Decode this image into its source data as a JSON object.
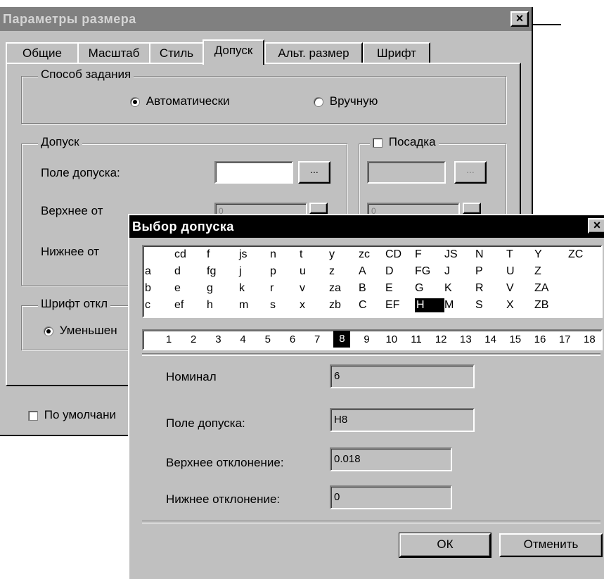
{
  "outer_dialog": {
    "title": "Параметры размера",
    "close_label": "×",
    "tabs": [
      {
        "label": "Общие"
      },
      {
        "label": "Масштаб"
      },
      {
        "label": "Стиль"
      },
      {
        "label": "Допуск"
      },
      {
        "label": "Альт. размер"
      },
      {
        "label": "Шрифт"
      }
    ],
    "method_group": {
      "legend": "Способ задания",
      "auto_label": "Автоматически",
      "manual_label": "Вручную"
    },
    "tolerance_group": {
      "legend": "Допуск",
      "field_label": "Поле допуска:",
      "upper_label": "Верхнее от",
      "lower_label": "Нижнее от",
      "upper_value": "0",
      "fit_upper_value": "0",
      "browse_label": "..."
    },
    "fit_group": {
      "legend": "Посадка",
      "browse_label": "..."
    },
    "font_group": {
      "legend": "Шрифт откл",
      "option_label": "Уменьшен"
    },
    "default_label": "По умолчани"
  },
  "tolerance_dialog": {
    "title": "Выбор допуска",
    "close_label": "×",
    "letter_grid": [
      [
        "",
        "cd",
        "f",
        "js",
        "n",
        "t",
        "y",
        "zc",
        "CD",
        "F",
        "JS",
        "N",
        "T",
        "Y",
        "ZC"
      ],
      [
        "a",
        "d",
        "fg",
        "j",
        "p",
        "u",
        "z",
        "A",
        "D",
        "FG",
        "J",
        "P",
        "U",
        "Z",
        ""
      ],
      [
        "b",
        "e",
        "g",
        "k",
        "r",
        "v",
        "za",
        "B",
        "E",
        "G",
        "K",
        "R",
        "V",
        "ZA",
        ""
      ],
      [
        "c",
        "ef",
        "h",
        "m",
        "s",
        "x",
        "zb",
        "C",
        "EF",
        "H",
        "M",
        "S",
        "X",
        "ZB",
        ""
      ]
    ],
    "selected_letter": "H",
    "grades": [
      "1",
      "2",
      "3",
      "4",
      "5",
      "6",
      "7",
      "8",
      "9",
      "10",
      "11",
      "12",
      "13",
      "14",
      "15",
      "16",
      "17",
      "18"
    ],
    "selected_grade": "8",
    "nominal_label": "Номинал",
    "nominal_value": "6",
    "field_label": "Поле допуска:",
    "field_value": "H8",
    "upper_label": "Верхнее отклонение:",
    "upper_value": "0.018",
    "lower_label": "Нижнее отклонение:",
    "lower_value": "0",
    "ok_label": "ОК",
    "cancel_label": "Отменить"
  },
  "colors": {
    "face": "#c0c0c0",
    "outer_title_bg": "#808080",
    "inner_title_bg": "#000000",
    "selection": "#000000"
  }
}
